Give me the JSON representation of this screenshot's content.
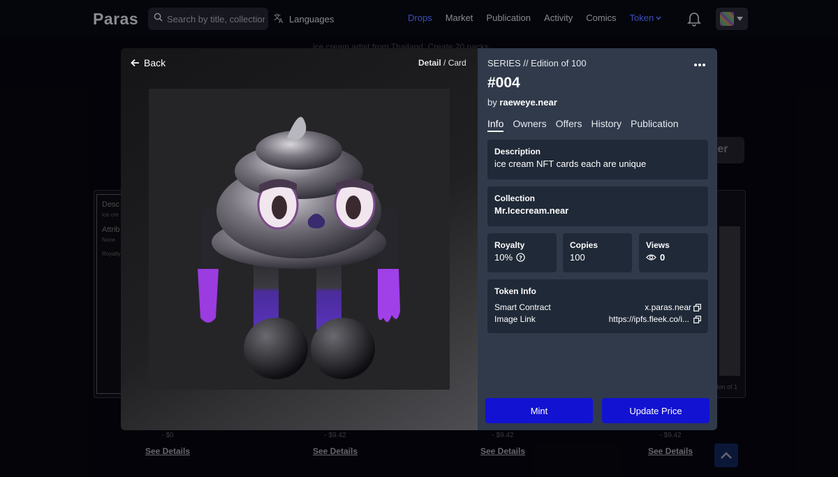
{
  "nav": {
    "logo": "Paras",
    "search_placeholder": "Search by title, collection",
    "languages": "Languages",
    "links": [
      "Drops",
      "Market",
      "Publication",
      "Activity",
      "Comics"
    ],
    "token": "Token"
  },
  "background": {
    "subtitle": "ice cream artist from Thailand. Create 20 packs...",
    "filter": "ter",
    "card_labels": [
      "Desc",
      "ice cre",
      "Attrib",
      "None",
      "Royalty"
    ],
    "edition": "tion of 1",
    "prices": [
      "- $0",
      "- $9.42",
      "- $9.42",
      "- $9.42"
    ],
    "see_details": "See Details"
  },
  "modal": {
    "back": "Back",
    "view_detail": "Detail",
    "view_card": "Card",
    "series": "SERIES // Edition of 100",
    "title": "#004",
    "by_prefix": "by",
    "creator": "raeweye.near",
    "tabs": [
      "Info",
      "Owners",
      "Offers",
      "History",
      "Publication"
    ],
    "description_label": "Description",
    "description": "ice cream NFT cards each are unique",
    "collection_label": "Collection",
    "collection": "Mr.Icecream.near",
    "royalty_label": "Royalty",
    "royalty": "10%",
    "copies_label": "Copies",
    "copies": "100",
    "views_label": "Views",
    "views": "0",
    "token_info_label": "Token Info",
    "smart_contract_label": "Smart Contract",
    "smart_contract": "x.paras.near",
    "image_link_label": "Image Link",
    "image_link": "https://ipfs.fleek.co/i...",
    "mint": "Mint",
    "update_price": "Update Price"
  },
  "colors": {
    "button": "#1212d2",
    "panel": "#303a4b",
    "box": "#1f2937",
    "nav_active": "#3b4fb8"
  }
}
